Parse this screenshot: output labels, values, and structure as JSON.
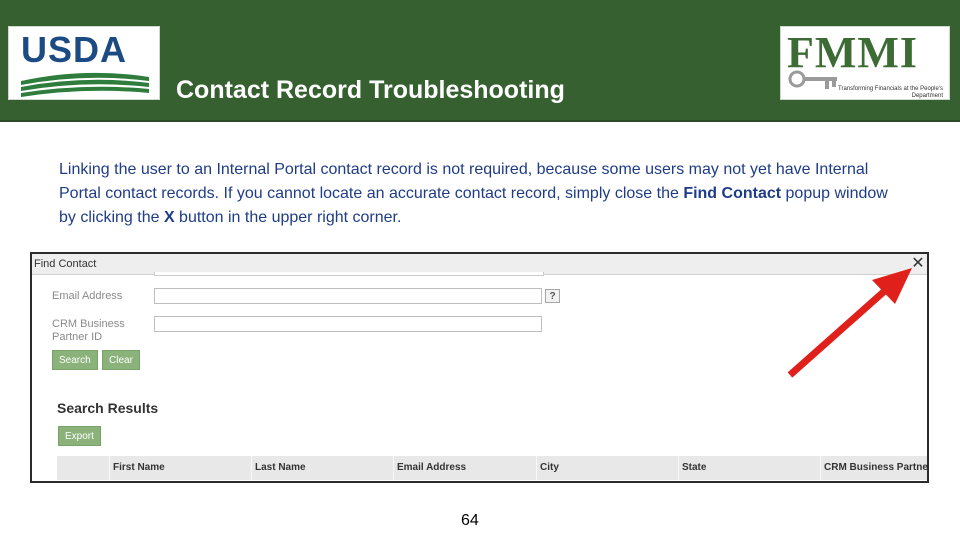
{
  "header": {
    "usda_logo_text": "USDA",
    "title": "Contact Record Troubleshooting",
    "fmmi_logo_text": "FMMI",
    "fmmi_tagline": "Transforming Financials at the People's Department"
  },
  "body": {
    "text_before_1": "Linking the user to an Internal Portal contact record is not required, because some users may not yet have Internal Portal contact records. If you cannot locate an accurate contact record, simply close the ",
    "bold_1": "Find Contact",
    "text_before_2": " popup window by clicking the ",
    "bold_2": "X",
    "text_after": " button in the upper right corner."
  },
  "popup": {
    "title": "Find Contact",
    "close_glyph": "✕",
    "fields": {
      "email_label": "Email Address",
      "email_value": "",
      "help_glyph": "?",
      "crm_label_line1": "CRM Business",
      "crm_label_line2": "Partner ID",
      "crm_value": ""
    },
    "buttons": {
      "search": "Search",
      "clear": "Clear",
      "export": "Export"
    },
    "results_title": "Search Results",
    "columns": [
      "First Name",
      "Last Name",
      "Email Address",
      "City",
      "State",
      "CRM Business Partner"
    ]
  },
  "annotation": {
    "arrow_color": "#e0201b"
  },
  "footer": {
    "page_number": "64"
  }
}
